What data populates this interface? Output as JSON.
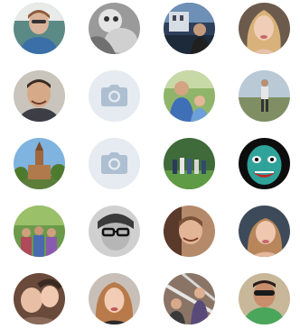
{
  "friends": {
    "rows": [
      [
        {
          "photo": "photo",
          "icon": "person-photo-icon"
        },
        {
          "photo": "photo",
          "icon": "person-photo-icon"
        },
        {
          "photo": "photo",
          "icon": "person-photo-icon"
        },
        {
          "photo": "photo",
          "icon": "person-photo-icon"
        }
      ],
      [
        {
          "photo": "photo",
          "icon": "person-photo-icon"
        },
        {
          "photo": "none",
          "icon": "camera-icon"
        },
        {
          "photo": "photo",
          "icon": "person-photo-icon"
        },
        {
          "photo": "photo",
          "icon": "person-photo-icon"
        }
      ],
      [
        {
          "photo": "photo",
          "icon": "church-photo-icon"
        },
        {
          "photo": "none",
          "icon": "camera-icon"
        },
        {
          "photo": "photo",
          "icon": "group-photo-icon"
        },
        {
          "photo": "photo",
          "icon": "mask-photo-icon"
        }
      ],
      [
        {
          "photo": "photo",
          "icon": "group-photo-icon"
        },
        {
          "photo": "photo",
          "icon": "person-photo-icon"
        },
        {
          "photo": "photo",
          "icon": "person-photo-icon"
        },
        {
          "photo": "photo",
          "icon": "person-photo-icon"
        }
      ],
      [
        {
          "photo": "photo",
          "icon": "person-photo-icon"
        },
        {
          "photo": "photo",
          "icon": "person-photo-icon"
        },
        {
          "photo": "photo",
          "icon": "person-photo-icon"
        },
        {
          "photo": "photo",
          "icon": "person-photo-icon"
        }
      ]
    ]
  },
  "colors": {
    "placeholder_bg": "#e5ebf1",
    "camera_icon": "#aebfd1",
    "background": "#ffffff"
  }
}
